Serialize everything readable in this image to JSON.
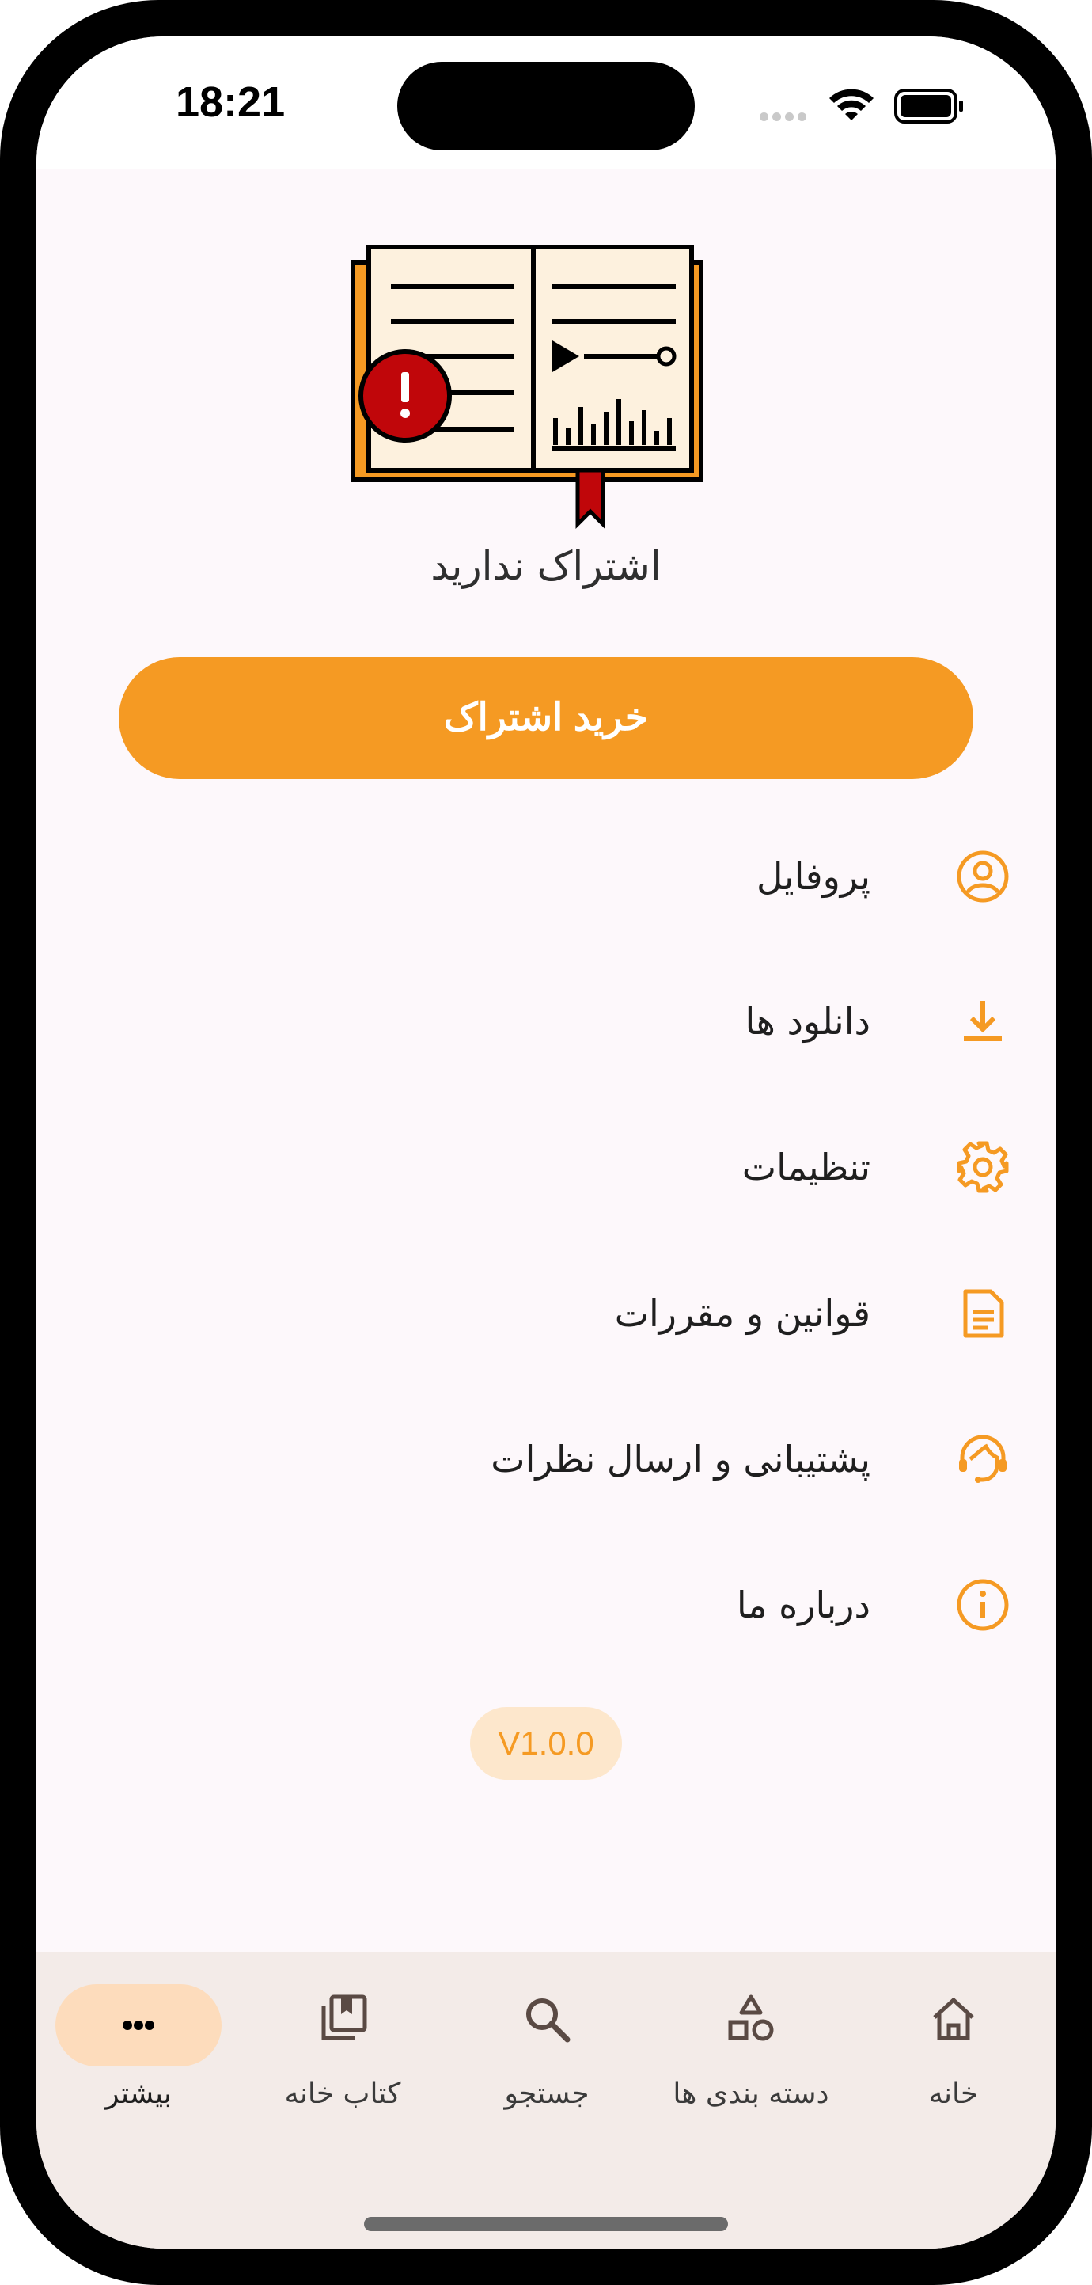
{
  "status_bar": {
    "time": "18:21"
  },
  "header": {
    "no_subscription_text": "اشتراک ندارید",
    "buy_button_label": "خرید اشتراک"
  },
  "menu": [
    {
      "label": "پروفایل",
      "icon": "profile-icon"
    },
    {
      "label": "دانلود ها",
      "icon": "download-icon"
    },
    {
      "label": "تنظیمات",
      "icon": "settings-icon"
    },
    {
      "label": "قوانین و مقررات",
      "icon": "document-icon"
    },
    {
      "label": "پشتیبانی و ارسال نظرات",
      "icon": "support-icon"
    },
    {
      "label": "درباره ما",
      "icon": "info-icon"
    }
  ],
  "version": "V1.0.0",
  "bottom_nav": [
    {
      "label": "بیشتر",
      "icon": "more-icon",
      "active": true
    },
    {
      "label": "کتاب خانه",
      "icon": "library-icon",
      "active": false
    },
    {
      "label": "جستجو",
      "icon": "search-icon",
      "active": false
    },
    {
      "label": "دسته بندی ها",
      "icon": "categories-icon",
      "active": false
    },
    {
      "label": "خانه",
      "icon": "home-icon",
      "active": false
    }
  ],
  "colors": {
    "accent": "#f59a23",
    "accent_light": "#fde7cc",
    "nav_active_pill": "#fddcbc",
    "nav_bg": "#f3ebe8",
    "alert_red": "#c0060a"
  }
}
